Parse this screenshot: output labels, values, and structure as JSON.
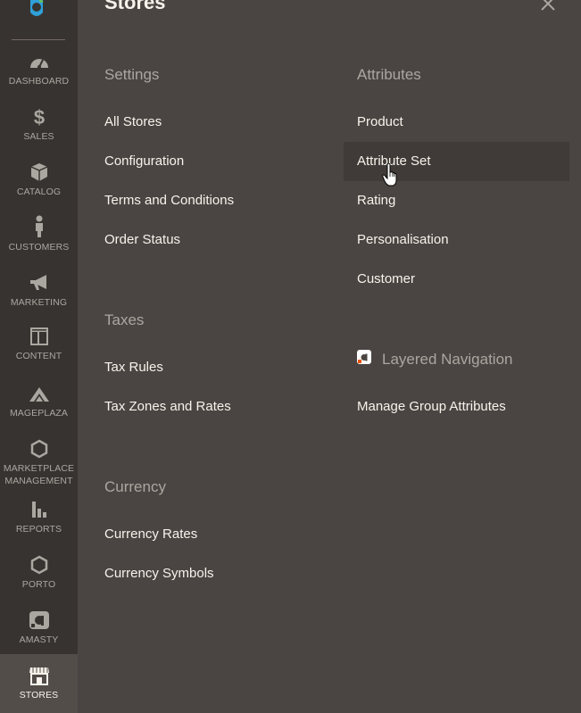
{
  "sidebar": {
    "items": [
      {
        "id": "dashboard",
        "label": "Dashboard",
        "icon": "gauge-icon"
      },
      {
        "id": "sales",
        "label": "Sales",
        "icon": "dollar-icon"
      },
      {
        "id": "catalog",
        "label": "Catalog",
        "icon": "cube-icon"
      },
      {
        "id": "customers",
        "label": "Customers",
        "icon": "person-icon"
      },
      {
        "id": "marketing",
        "label": "Marketing",
        "icon": "megaphone-icon"
      },
      {
        "id": "content",
        "label": "Content",
        "icon": "layout-icon"
      },
      {
        "id": "mageplaza",
        "label": "Mageplaza",
        "icon": "mageplaza-icon"
      },
      {
        "id": "marketplace",
        "label_line1": "Marketplace",
        "label_line2": "Management",
        "icon": "hexagon-icon"
      },
      {
        "id": "reports",
        "label": "Reports",
        "icon": "bar-chart-icon"
      },
      {
        "id": "porto",
        "label": "Porto",
        "icon": "hexagon-icon"
      },
      {
        "id": "amasty",
        "label": "Amasty",
        "icon": "amasty-icon"
      },
      {
        "id": "stores",
        "label": "Stores",
        "icon": "storefront-icon",
        "active": true
      }
    ]
  },
  "panel": {
    "title": "Stores",
    "settings": {
      "title": "Settings",
      "links": [
        "All Stores",
        "Configuration",
        "Terms and Conditions",
        "Order Status"
      ]
    },
    "taxes": {
      "title": "Taxes",
      "links": [
        "Tax Rules",
        "Tax Zones and Rates"
      ]
    },
    "currency": {
      "title": "Currency",
      "links": [
        "Currency Rates",
        "Currency Symbols"
      ]
    },
    "attributes": {
      "title": "Attributes",
      "links": [
        "Product",
        "Attribute Set",
        "Rating",
        "Personalisation",
        "Customer"
      ],
      "hovered": "Attribute Set"
    },
    "layered_navigation": {
      "title": "Layered Navigation",
      "links": [
        "Manage Group Attributes"
      ]
    }
  },
  "colors": {
    "sidebar_bg": "#373330",
    "panel_bg": "#4a4542",
    "active_bg": "#524d49",
    "hover_bg": "#403b38",
    "link_text": "#f7f3eb",
    "muted_text": "#aaa6a0",
    "brand_accent": "#eb5202"
  }
}
